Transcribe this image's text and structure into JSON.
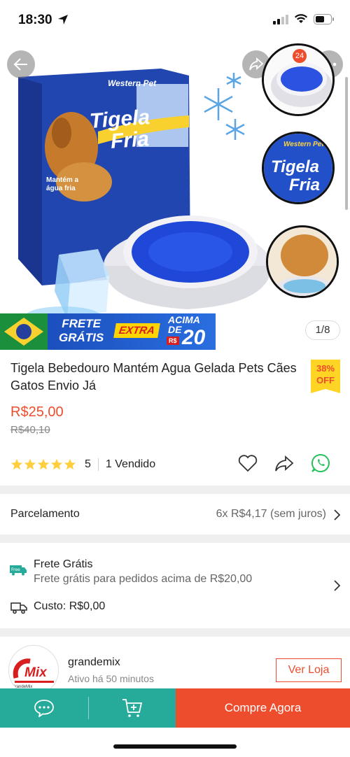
{
  "status_bar": {
    "time": "18:30"
  },
  "hero": {
    "cart_count": "24",
    "box_brand": "Western Pet",
    "box_title_line1": "Tigela",
    "box_title_line2": "Fria",
    "box_side_text": "Mantém a água fria",
    "thumb_brand": "Western Pet",
    "thumb_title_line1": "Tigela",
    "thumb_title_line2": "Fria",
    "promo": {
      "line1": "FRETE",
      "line2": "GRÁTIS",
      "extra": "EXTRA",
      "acima1": "ACIMA",
      "acima2": "DE",
      "rs": "R$",
      "amount": "20"
    },
    "page_indicator": "1/8"
  },
  "product": {
    "title": "Tigela Bebedouro Mantém Agua Gelada Pets Cães Gatos Envio Já",
    "discount_pct": "38%",
    "discount_label": "OFF",
    "price": "R$25,00",
    "old_price": "R$40,10",
    "rating": "5",
    "rating_value": 5,
    "sold": "1 Vendido"
  },
  "installments": {
    "label": "Parcelamento",
    "value": "6x R$4,17 (sem juros)"
  },
  "shipping": {
    "free_icon_text": "Free",
    "title": "Frete Grátis",
    "subtitle": "Frete grátis para pedidos acima de R$20,00",
    "cost": "Custo: R$0,00"
  },
  "shop": {
    "logo_text": "Mix",
    "logo_sub": "GrandeMix",
    "name": "grandemix",
    "active": "Ativo há 50 minutos",
    "visit_label": "Ver Loja"
  },
  "bottom_bar": {
    "buy_label": "Compre Agora"
  },
  "colors": {
    "accent": "#ee4d2d",
    "teal": "#26aa99",
    "star": "#ffce3d",
    "whatsapp": "#25c15a"
  }
}
